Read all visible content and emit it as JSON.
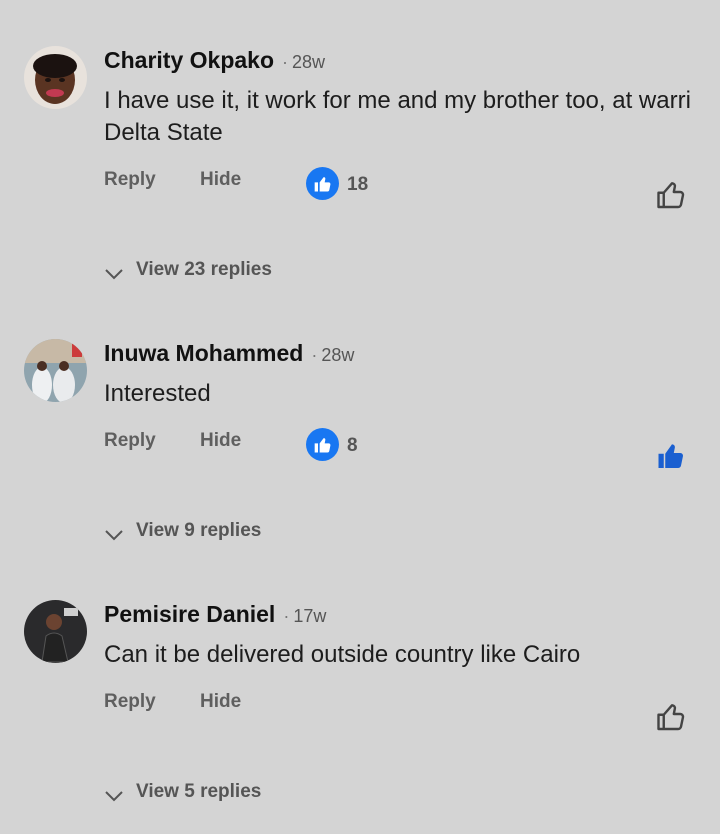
{
  "comments": [
    {
      "author": "Charity Okpako",
      "time": "28w",
      "text": "I have use it, it work for me and my brother too, at warri Delta State",
      "reply_label": "Reply",
      "hide_label": "Hide",
      "reaction_count": "18",
      "liked": false,
      "view_replies": "View 23 replies"
    },
    {
      "author": "Inuwa Mohammed",
      "time": "28w",
      "text": "Interested",
      "reply_label": "Reply",
      "hide_label": "Hide",
      "reaction_count": "8",
      "liked": true,
      "view_replies": "View 9 replies"
    },
    {
      "author": "Pemisire Daniel",
      "time": "17w",
      "text": "Can it be delivered outside country like Cairo",
      "reply_label": "Reply",
      "hide_label": "Hide",
      "liked": false,
      "view_replies": "View 5 replies"
    }
  ],
  "separator": "·",
  "colors": {
    "reaction_blue": "#1877f2",
    "liked_blue": "#1a5fd0",
    "background": "#d4d4d4"
  },
  "icons": {
    "reaction": "thumbs-up-icon",
    "like": "thumbs-up-outline-icon",
    "liked": "thumbs-up-filled-icon",
    "expand": "chevron-down-icon"
  }
}
